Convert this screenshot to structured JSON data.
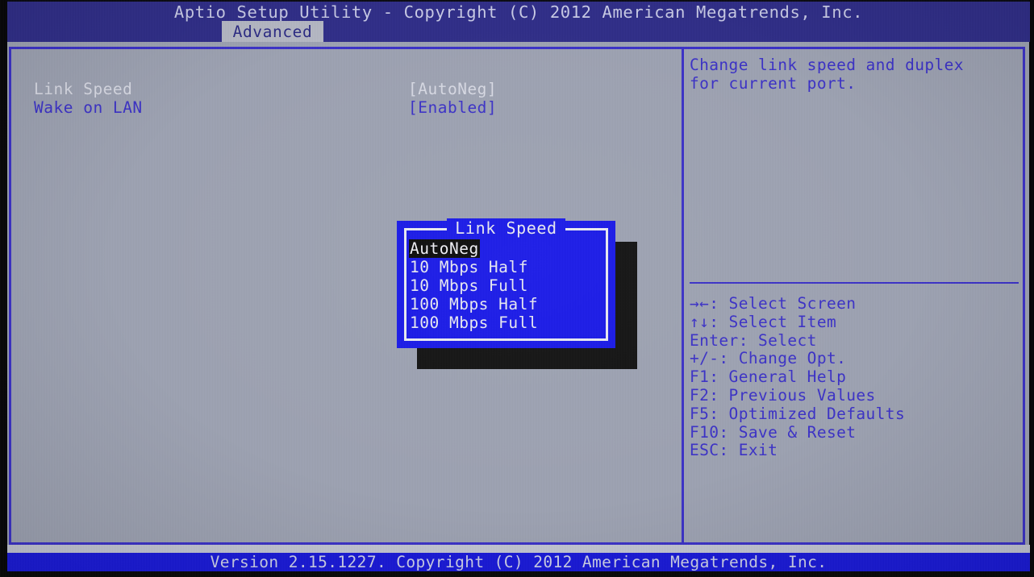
{
  "header": {
    "title": "Aptio Setup Utility - Copyright (C) 2012 American Megatrends, Inc.",
    "active_tab": "Advanced"
  },
  "settings": [
    {
      "label": "Link Speed",
      "value": "[AutoNeg]",
      "selected": true
    },
    {
      "label": "Wake on LAN",
      "value": "[Enabled]",
      "selected": false
    }
  ],
  "help": {
    "description": "Change link speed and duplex\nfor current port.",
    "keys": [
      "→←: Select Screen",
      "↑↓: Select Item",
      "Enter: Select",
      "+/-: Change Opt.",
      "F1: General Help",
      "F2: Previous Values",
      "F5: Optimized Defaults",
      "F10: Save & Reset",
      "ESC: Exit"
    ]
  },
  "dialog": {
    "title": "Link Speed",
    "options": [
      {
        "label": "AutoNeg",
        "selected": true
      },
      {
        "label": "10 Mbps Half",
        "selected": false
      },
      {
        "label": "10 Mbps Full",
        "selected": false
      },
      {
        "label": "100 Mbps Half",
        "selected": false
      },
      {
        "label": "100 Mbps Full",
        "selected": false
      }
    ]
  },
  "footer": {
    "text": "Version 2.15.1227. Copyright (C) 2012 American Megatrends, Inc."
  },
  "colors": {
    "title_bar": "#2f2d88",
    "content_bg": "#9da2b2",
    "accent_blue": "#3b31c7",
    "dialog_bg": "#1919e8",
    "footer_bg": "#1a1ad8",
    "selected_text": "#d8dae4",
    "highlight_bg": "#0a0a0a"
  }
}
